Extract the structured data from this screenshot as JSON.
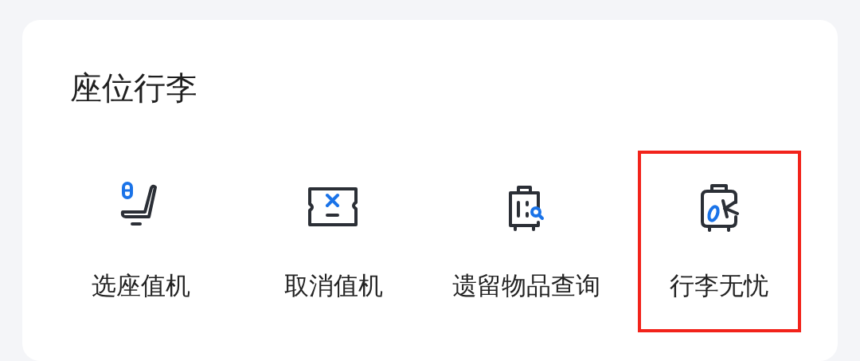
{
  "section": {
    "title": "座位行李",
    "items": [
      {
        "label": "选座值机",
        "kind": "seat",
        "highlighted": false
      },
      {
        "label": "取消值机",
        "kind": "ticket",
        "highlighted": false
      },
      {
        "label": "遗留物品查询",
        "kind": "search",
        "highlighted": false
      },
      {
        "label": "行李无忧",
        "kind": "ok",
        "highlighted": true
      }
    ]
  }
}
